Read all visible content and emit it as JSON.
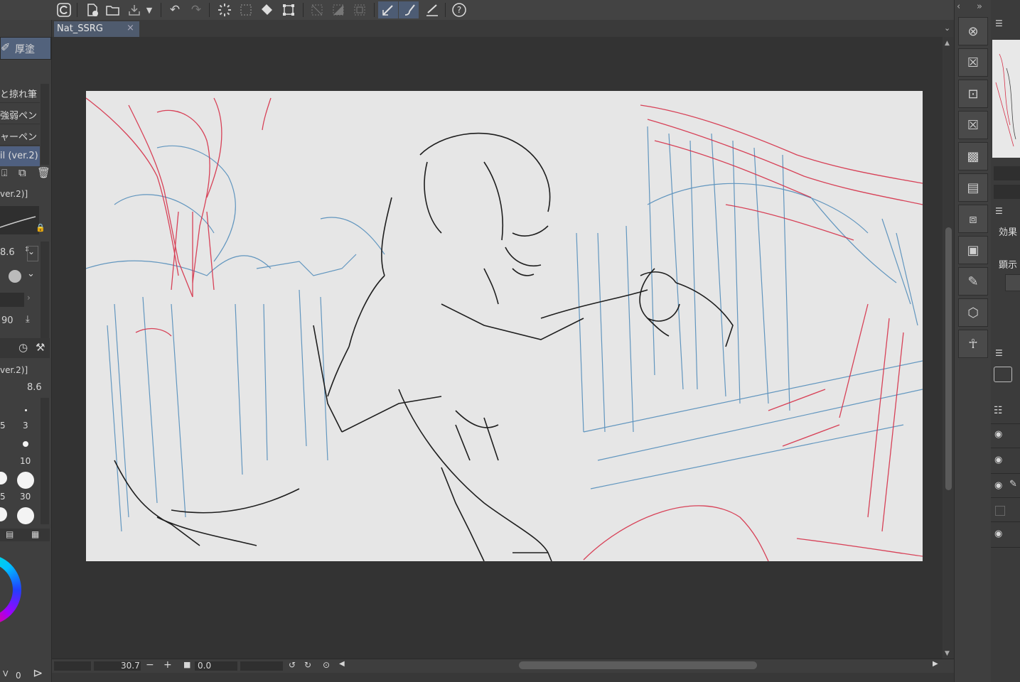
{
  "toolbar": {
    "icons": [
      "app-logo-icon",
      "new-file-icon",
      "open-folder-icon",
      "save-icon",
      "dropdown-icon",
      "undo-icon",
      "redo-icon",
      "loading-icon",
      "select-rect-icon",
      "fill-icon",
      "transform-icon",
      "grid-icon",
      "deselect-icon",
      "invert-icon",
      "pen-active-icon",
      "brush-icon",
      "eraser-line-icon",
      "help-icon"
    ]
  },
  "tabs": [
    {
      "label": "Nat_SSRG",
      "close": "×"
    }
  ],
  "tool_panel": {
    "active_tool": "厚塗",
    "brush_list": [
      "と掠れ筆",
      "強弱ペン",
      "ャーペン",
      "il (ver.2)"
    ],
    "sub_tool_label": "ver.2)]",
    "size_value": "8.6",
    "opacity_value": "90",
    "sub_tool_label2": "ver.2)]",
    "size_value2": "8.6",
    "size_presets": [
      "5",
      "3",
      "10",
      "5",
      "30"
    ],
    "color_value": "0"
  },
  "status": {
    "zoom": "30.7",
    "minus": "−",
    "plus": "+",
    "angle": "0.0"
  },
  "right_panel": {
    "effect_label": "効果",
    "display_label": "顕示"
  },
  "colors": {
    "sketch_red": "#d63048",
    "sketch_blue": "#4a88b8",
    "line_black": "#1e1e1e",
    "accent": "#4f6080",
    "paper": "#e6e6e6"
  }
}
